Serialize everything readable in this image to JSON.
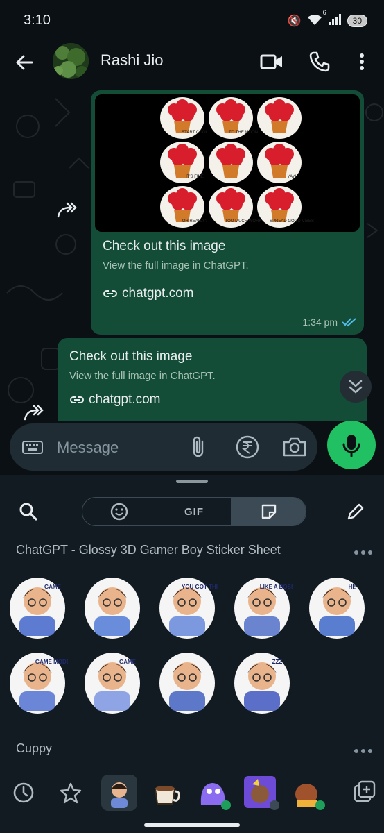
{
  "status_bar": {
    "time": "3:10",
    "signal_badge": "6",
    "battery": "30"
  },
  "header": {
    "contact_name": "Rashi Jio"
  },
  "messages": [
    {
      "title": "Check out this image",
      "subtitle": "View the full image in ChatGPT.",
      "link": "chatgpt.com",
      "time": "1:34 pm",
      "has_image": true
    },
    {
      "title": "Check out this image",
      "subtitle": "View the full image in ChatGPT.",
      "link": "chatgpt.com"
    }
  ],
  "image_sticker_captions": [
    "START COOL",
    "TO THE MOON",
    "IT'S FINE",
    "YAY!",
    "OH REALLY?",
    "TOO MUCH WORK",
    "SPREAD GOOD VIBES"
  ],
  "composer": {
    "placeholder": "Message"
  },
  "sticker_panel": {
    "tabs": [
      "emoji",
      "GIF",
      "sticker"
    ],
    "active_tab": "sticker",
    "packs": [
      {
        "title": "ChatGPT - Glossy 3D Gamer Boy Sticker Sheet",
        "sticker_captions": [
          "GAME",
          "YOU GOT THIS!",
          "LIKE A BOSS",
          "HI!",
          "GAME MODE",
          "GAME",
          "ZZZ"
        ]
      },
      {
        "title": "Cuppy"
      }
    ]
  },
  "colors": {
    "accent": "#21c063",
    "bubble": "#144d37",
    "background": "#0b1014",
    "panel": "#121b22"
  }
}
